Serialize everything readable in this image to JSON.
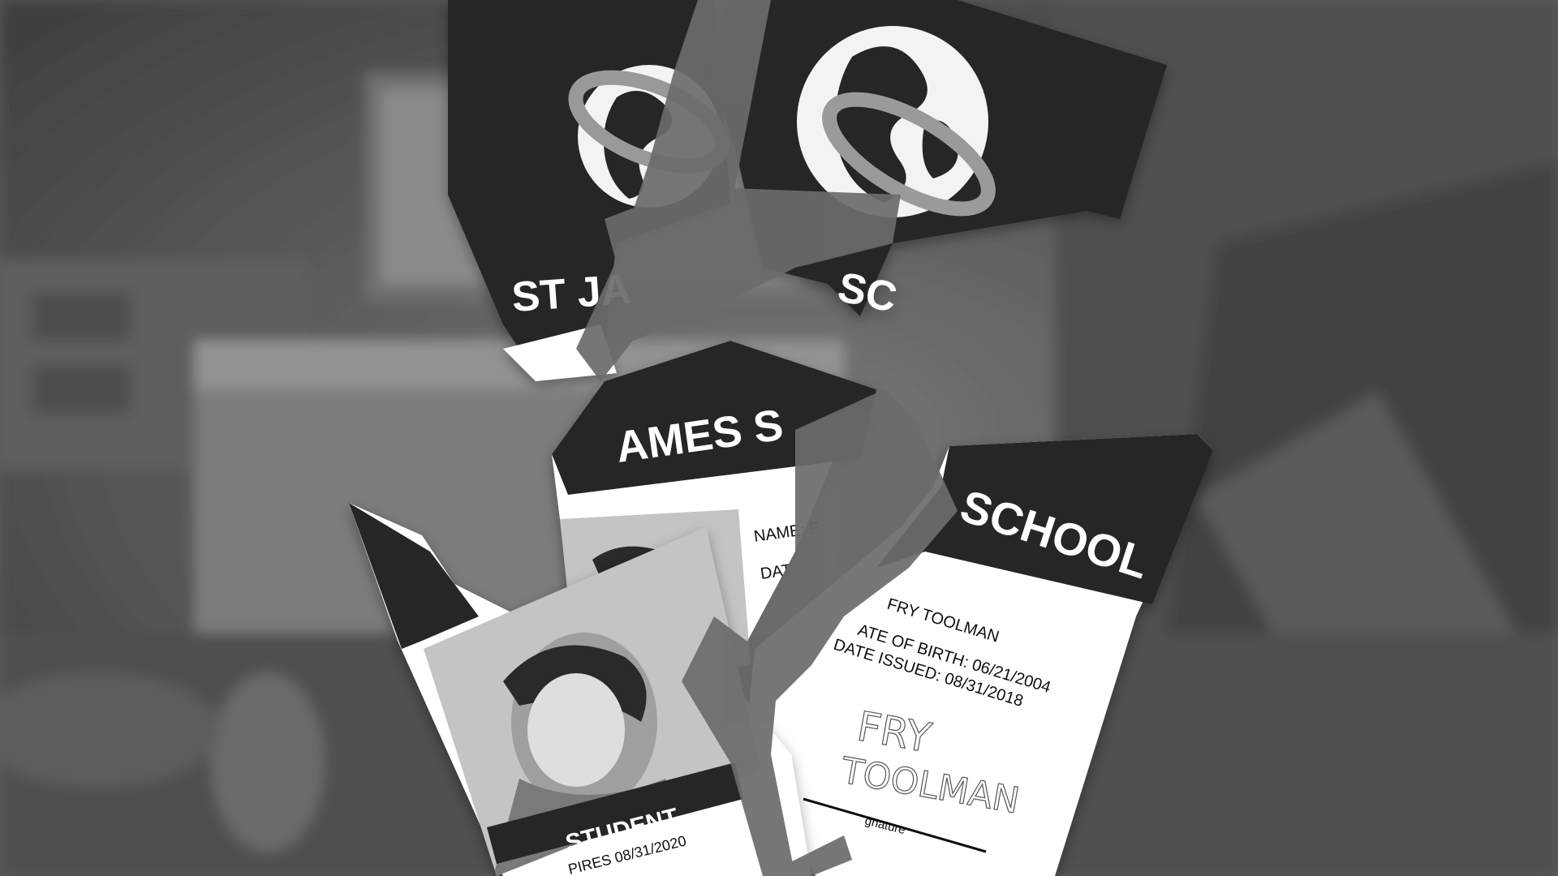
{
  "scene": {
    "description_free": true,
    "colors": {
      "card_dark": "#262626",
      "card_light": "#ffffff",
      "photo_bg": "#c4c4c4",
      "gap_gray": "#6b6b6b",
      "bg_base": "#5c5c5c"
    }
  },
  "id_card": {
    "school_fragment_left": "ST JA",
    "school_fragment_right": "SC",
    "school_fragment_mid": "AMES S",
    "school_fragment_school": "SCHOOL",
    "name_fragment": "NAME: F",
    "name_fragment_right": "FRY TOOLMAN",
    "dob_fragment_left": "DAT",
    "dob_fragment_right": "ATE OF BIRTH: 06/21/2004",
    "date_issued": "DATE ISSUED: 08/31/2018",
    "role": "STUDENT",
    "expires": "PIRES 08/31/2020",
    "signature_label": "gnature",
    "signature_line1": "FRY",
    "signature_line2": "TOOLMAN"
  },
  "icons": {
    "logo": "globe-with-ring-icon"
  }
}
